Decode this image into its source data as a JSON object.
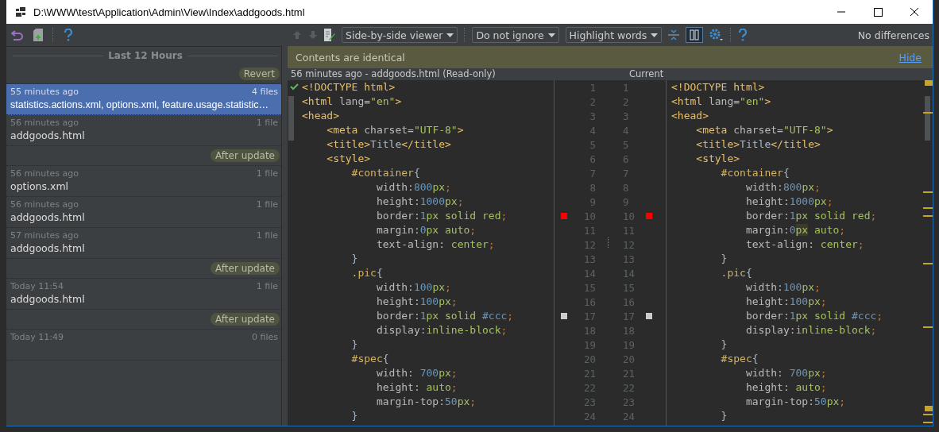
{
  "window": {
    "title": "D:\\WWW\\test\\Application\\Admin\\View\\Index\\addgoods.html"
  },
  "history": {
    "header": "Last 12 Hours",
    "items": [
      {
        "kind": "label",
        "text": "Revert"
      },
      {
        "kind": "change",
        "time": "55 minutes ago",
        "count": "4 files",
        "files": "statistics.actions.xml, options.xml, feature.usage.statistic…",
        "selected": true
      },
      {
        "kind": "change",
        "time": "56 minutes ago",
        "count": "1 file",
        "files": "addgoods.html",
        "selected": false
      },
      {
        "kind": "label",
        "text": "After update"
      },
      {
        "kind": "change",
        "time": "56 minutes ago",
        "count": "1 file",
        "files": "options.xml",
        "selected": false
      },
      {
        "kind": "change",
        "time": "56 minutes ago",
        "count": "1 file",
        "files": "addgoods.html",
        "selected": false
      },
      {
        "kind": "change",
        "time": "57 minutes ago",
        "count": "1 file",
        "files": "addgoods.html",
        "selected": false
      },
      {
        "kind": "label",
        "text": "After update"
      },
      {
        "kind": "change",
        "time": "Today 11:54",
        "count": "1 file",
        "files": "addgoods.html",
        "selected": false
      },
      {
        "kind": "label",
        "text": "After update"
      },
      {
        "kind": "change",
        "time": "Today 11:49",
        "count": "0 files",
        "selected": false
      }
    ]
  },
  "diff_toolbar": {
    "viewer": "Side-by-side viewer",
    "ignore": "Do not ignore",
    "highlight": "Highlight words",
    "status": "No differences"
  },
  "notification": {
    "text": "Contents are identical",
    "link": "Hide"
  },
  "left_title": "56 minutes ago - addgoods.html (Read-only)",
  "right_title": "Current",
  "left_lines": [
    {
      "number": "1",
      "tokens": [
        {
          "kind": "tag",
          "text": "<!DOCTYPE html>"
        }
      ]
    },
    {
      "number": "2",
      "tokens": [
        {
          "kind": "tag",
          "text": "<html"
        },
        {
          "kind": "attr",
          "text": " lang="
        },
        {
          "kind": "str",
          "text": "\"en\""
        },
        {
          "kind": "tag",
          "text": ">"
        }
      ]
    },
    {
      "number": "3",
      "tokens": [
        {
          "kind": "tag",
          "text": "<head>"
        }
      ]
    },
    {
      "number": "4",
      "tokens": [
        {
          "kind": "tag",
          "text": "    <meta"
        },
        {
          "kind": "attr",
          "text": " charset="
        },
        {
          "kind": "str",
          "text": "\"UTF-8\""
        },
        {
          "kind": "tag",
          "text": ">"
        }
      ]
    },
    {
      "number": "5",
      "tokens": [
        {
          "kind": "tag",
          "text": "    <title>"
        },
        {
          "kind": "txt",
          "text": "Title"
        },
        {
          "kind": "tag",
          "text": "</title>"
        }
      ]
    },
    {
      "number": "6",
      "tokens": [
        {
          "kind": "tag",
          "text": "    <style>"
        }
      ]
    },
    {
      "number": "7",
      "tokens": [
        {
          "kind": "sel",
          "text": "        #container"
        },
        {
          "kind": "brace",
          "text": "{"
        }
      ]
    },
    {
      "number": "8",
      "tokens": [
        {
          "kind": "prop",
          "text": "            width:"
        },
        {
          "kind": "num",
          "text": "800"
        },
        {
          "kind": "unit",
          "text": "px"
        },
        {
          "kind": "semi",
          "text": ";"
        }
      ]
    },
    {
      "number": "9",
      "tokens": [
        {
          "kind": "prop",
          "text": "            height:"
        },
        {
          "kind": "num",
          "text": "1000"
        },
        {
          "kind": "unit",
          "text": "px"
        },
        {
          "kind": "semi",
          "text": ";"
        }
      ]
    },
    {
      "number": "10",
      "color": "#ff0000",
      "tokens": [
        {
          "kind": "prop",
          "text": "            border:"
        },
        {
          "kind": "num",
          "text": "1"
        },
        {
          "kind": "unit",
          "text": "px"
        },
        {
          "kind": "val",
          "text": " solid red"
        },
        {
          "kind": "semi",
          "text": ";"
        }
      ]
    },
    {
      "number": "11",
      "tokens": [
        {
          "kind": "prop",
          "text": "            margin:"
        },
        {
          "kind": "num",
          "text": "0"
        },
        {
          "kind": "unit",
          "text": "px"
        },
        {
          "kind": "val",
          "text": " auto"
        },
        {
          "kind": "semi",
          "text": ";"
        }
      ]
    },
    {
      "number": "12",
      "tokens": [
        {
          "kind": "prop",
          "text": "            text-align: "
        },
        {
          "kind": "val",
          "text": "center"
        },
        {
          "kind": "semi",
          "text": ";"
        }
      ]
    },
    {
      "number": "13",
      "tokens": [
        {
          "kind": "brace",
          "text": "        }"
        }
      ]
    },
    {
      "number": "14",
      "tokens": [
        {
          "kind": "sel",
          "text": "        .pic"
        },
        {
          "kind": "brace",
          "text": "{"
        }
      ]
    },
    {
      "number": "15",
      "tokens": [
        {
          "kind": "prop",
          "text": "            width:"
        },
        {
          "kind": "num",
          "text": "100"
        },
        {
          "kind": "unit",
          "text": "px"
        },
        {
          "kind": "semi",
          "text": ";"
        }
      ]
    },
    {
      "number": "16",
      "tokens": [
        {
          "kind": "prop",
          "text": "            height:"
        },
        {
          "kind": "num",
          "text": "100"
        },
        {
          "kind": "unit",
          "text": "px"
        },
        {
          "kind": "semi",
          "text": ";"
        }
      ]
    },
    {
      "number": "17",
      "color": "#cccccc",
      "tokens": [
        {
          "kind": "prop",
          "text": "            border:"
        },
        {
          "kind": "num",
          "text": "1"
        },
        {
          "kind": "unit",
          "text": "px"
        },
        {
          "kind": "val",
          "text": " solid "
        },
        {
          "kind": "num",
          "text": "#ccc"
        },
        {
          "kind": "semi",
          "text": ";"
        }
      ]
    },
    {
      "number": "18",
      "tokens": [
        {
          "kind": "prop",
          "text": "            display:"
        },
        {
          "kind": "val",
          "text": "inline-block"
        },
        {
          "kind": "semi",
          "text": ";"
        }
      ]
    },
    {
      "number": "19",
      "tokens": [
        {
          "kind": "brace",
          "text": "        }"
        }
      ]
    },
    {
      "number": "20",
      "tokens": [
        {
          "kind": "sel",
          "text": "        #spec"
        },
        {
          "kind": "brace",
          "text": "{"
        }
      ]
    },
    {
      "number": "21",
      "tokens": [
        {
          "kind": "prop",
          "text": "            width: "
        },
        {
          "kind": "num",
          "text": "700"
        },
        {
          "kind": "unit",
          "text": "px"
        },
        {
          "kind": "semi",
          "text": ";"
        }
      ]
    },
    {
      "number": "22",
      "tokens": [
        {
          "kind": "prop",
          "text": "            height: "
        },
        {
          "kind": "val",
          "text": "auto"
        },
        {
          "kind": "semi",
          "text": ";"
        }
      ]
    },
    {
      "number": "23",
      "tokens": [
        {
          "kind": "prop",
          "text": "            margin-top:"
        },
        {
          "kind": "num",
          "text": "50"
        },
        {
          "kind": "unit",
          "text": "px"
        },
        {
          "kind": "semi",
          "text": ";"
        }
      ]
    },
    {
      "number": "24",
      "tokens": [
        {
          "kind": "brace",
          "text": "        }"
        }
      ]
    }
  ],
  "right_lines": [
    {
      "number": "1",
      "tokens": [
        {
          "kind": "tag",
          "text": "<!DOCTYPE html>"
        }
      ]
    },
    {
      "number": "2",
      "tokens": [
        {
          "kind": "tag",
          "text": "<html"
        },
        {
          "kind": "attr",
          "text": " lang="
        },
        {
          "kind": "str",
          "text": "\"en\""
        },
        {
          "kind": "tag",
          "text": ">"
        }
      ]
    },
    {
      "number": "3",
      "tokens": [
        {
          "kind": "tag",
          "text": "<head>"
        }
      ]
    },
    {
      "number": "4",
      "tokens": [
        {
          "kind": "tag",
          "text": "    <meta"
        },
        {
          "kind": "attr",
          "text": " charset="
        },
        {
          "kind": "str",
          "text": "\"UTF-8\""
        },
        {
          "kind": "tag",
          "text": ">"
        }
      ]
    },
    {
      "number": "5",
      "tokens": [
        {
          "kind": "tag",
          "text": "    <title>"
        },
        {
          "kind": "txt",
          "text": "Title"
        },
        {
          "kind": "tag",
          "text": "</title>"
        }
      ]
    },
    {
      "number": "6",
      "tokens": [
        {
          "kind": "tag",
          "text": "    <style>"
        }
      ]
    },
    {
      "number": "7",
      "tokens": [
        {
          "kind": "sel",
          "text": "        #container"
        },
        {
          "kind": "brace",
          "text": "{"
        }
      ]
    },
    {
      "number": "8",
      "tokens": [
        {
          "kind": "prop",
          "text": "            width:"
        },
        {
          "kind": "num",
          "text": "800"
        },
        {
          "kind": "unit",
          "text": "px"
        },
        {
          "kind": "semi",
          "text": ";"
        }
      ]
    },
    {
      "number": "9",
      "tokens": [
        {
          "kind": "prop",
          "text": "            height:"
        },
        {
          "kind": "num",
          "text": "1000"
        },
        {
          "kind": "unit",
          "text": "px"
        },
        {
          "kind": "semi",
          "text": ";"
        }
      ]
    },
    {
      "number": "10",
      "color": "#ff0000",
      "tokens": [
        {
          "kind": "prop",
          "text": "            border:"
        },
        {
          "kind": "num",
          "text": "1"
        },
        {
          "kind": "unit",
          "text": "px"
        },
        {
          "kind": "val",
          "text": " solid red"
        },
        {
          "kind": "semi",
          "text": ";"
        }
      ]
    },
    {
      "number": "11",
      "tokens": [
        {
          "kind": "prop",
          "text": "            margin:"
        },
        {
          "kind": "num",
          "text": "0"
        },
        {
          "kind": "unit_hl",
          "text": "px"
        },
        {
          "kind": "val",
          "text": " auto"
        },
        {
          "kind": "semi",
          "text": ";"
        }
      ]
    },
    {
      "number": "12",
      "tokens": [
        {
          "kind": "prop",
          "text": "            text-align: "
        },
        {
          "kind": "val",
          "text": "center"
        },
        {
          "kind": "semi",
          "text": ";"
        }
      ]
    },
    {
      "number": "13",
      "tokens": [
        {
          "kind": "brace",
          "text": "        }"
        }
      ]
    },
    {
      "number": "14",
      "tokens": [
        {
          "kind": "sel",
          "text": "        .pic"
        },
        {
          "kind": "brace",
          "text": "{"
        }
      ]
    },
    {
      "number": "15",
      "tokens": [
        {
          "kind": "prop",
          "text": "            width:"
        },
        {
          "kind": "num",
          "text": "100"
        },
        {
          "kind": "unit",
          "text": "px"
        },
        {
          "kind": "semi",
          "text": ";"
        }
      ]
    },
    {
      "number": "16",
      "tokens": [
        {
          "kind": "prop",
          "text": "            height:"
        },
        {
          "kind": "num",
          "text": "100"
        },
        {
          "kind": "unit",
          "text": "px"
        },
        {
          "kind": "semi",
          "text": ";"
        }
      ]
    },
    {
      "number": "17",
      "color": "#cccccc",
      "tokens": [
        {
          "kind": "prop",
          "text": "            border:"
        },
        {
          "kind": "num",
          "text": "1"
        },
        {
          "kind": "unit",
          "text": "px"
        },
        {
          "kind": "val",
          "text": " solid "
        },
        {
          "kind": "num",
          "text": "#ccc"
        },
        {
          "kind": "semi",
          "text": ";"
        }
      ]
    },
    {
      "number": "18",
      "tokens": [
        {
          "kind": "prop",
          "text": "            display:"
        },
        {
          "kind": "val",
          "text": "inline-block"
        },
        {
          "kind": "semi",
          "text": ";"
        }
      ]
    },
    {
      "number": "19",
      "tokens": [
        {
          "kind": "brace",
          "text": "        }"
        }
      ]
    },
    {
      "number": "20",
      "tokens": [
        {
          "kind": "sel",
          "text": "        #spec"
        },
        {
          "kind": "brace",
          "text": "{"
        }
      ]
    },
    {
      "number": "21",
      "tokens": [
        {
          "kind": "prop",
          "text": "            width: "
        },
        {
          "kind": "num",
          "text": "700"
        },
        {
          "kind": "unit",
          "text": "px"
        },
        {
          "kind": "semi",
          "text": ";"
        }
      ]
    },
    {
      "number": "22",
      "tokens": [
        {
          "kind": "prop",
          "text": "            height: "
        },
        {
          "kind": "val",
          "text": "auto"
        },
        {
          "kind": "semi",
          "text": ";"
        }
      ]
    },
    {
      "number": "23",
      "tokens": [
        {
          "kind": "prop",
          "text": "            margin-top:"
        },
        {
          "kind": "num",
          "text": "50"
        },
        {
          "kind": "unit",
          "text": "px"
        },
        {
          "kind": "semi",
          "text": ";"
        }
      ]
    },
    {
      "number": "24",
      "tokens": [
        {
          "kind": "brace",
          "text": "        }"
        }
      ]
    }
  ]
}
